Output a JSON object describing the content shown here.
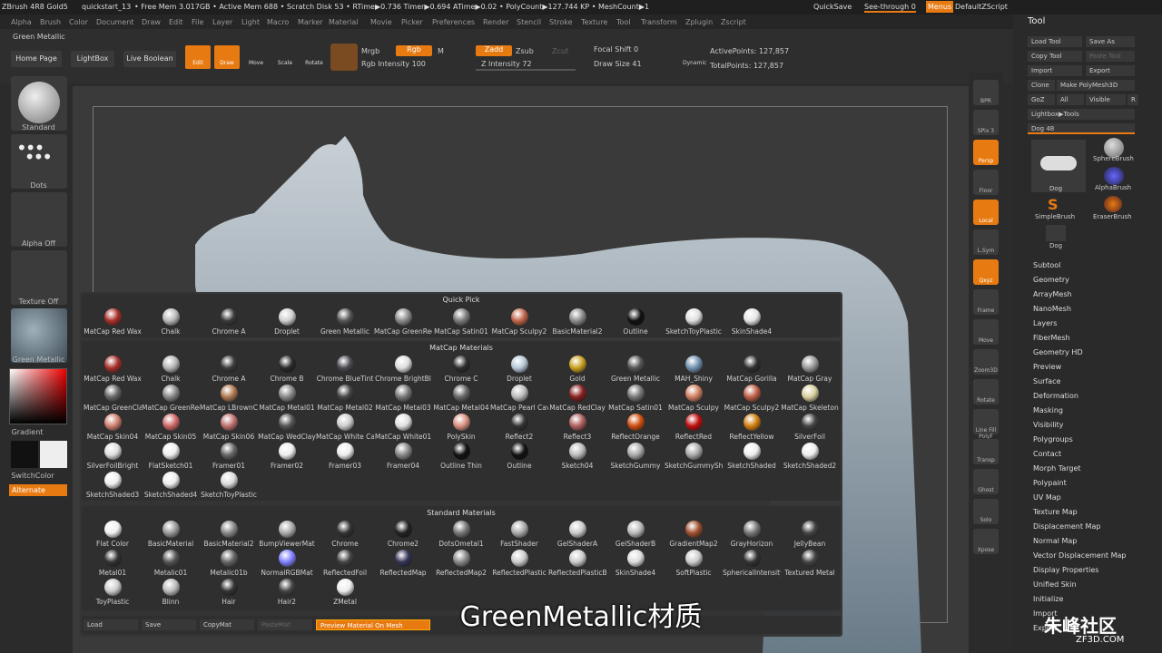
{
  "titlebar": {
    "items": [
      "ZBrush 4R8 Gold5",
      "quickstart_13",
      "• Free Mem 3.017GB • Active Mem 688 • Scratch Disk 53 • RTime▶0.736 Timer▶0.694 ATime▶0.02 • PolyCount▶127.744 KP • MeshCount▶1"
    ],
    "quicksave": "QuickSave",
    "seethrough": "See-through  0",
    "menus": "Menus",
    "script": "DefaultZScript"
  },
  "menu": [
    "Alpha",
    "Brush",
    "Color",
    "Document",
    "Draw",
    "Edit",
    "File",
    "Layer",
    "Light",
    "Macro",
    "Marker",
    "Material",
    "Movie",
    "Picker",
    "Preferences",
    "Render",
    "Stencil",
    "Stroke",
    "Texture",
    "Tool",
    "Transform",
    "Zplugin",
    "Zscript"
  ],
  "toolbar": {
    "material_name": "Green Metallic",
    "home": "Home Page",
    "lightbox": "LightBox",
    "liveboolean": "Live Boolean",
    "edit": "Edit",
    "draw": "Draw",
    "move": "Move",
    "scale": "Scale",
    "rotate": "Rotate",
    "mrgb": "Mrgb",
    "rgb": "Rgb",
    "m": "M",
    "zadd": "Zadd",
    "zsub": "Zsub",
    "zcut": "Zcut",
    "rgb_int": "Rgb Intensity 100",
    "z_int": "Z Intensity 72",
    "focal": "Focal Shift 0",
    "drawsize": "Draw Size 41",
    "dynamic": "Dynamic",
    "active": "ActivePoints: 127,857",
    "total": "TotalPoints: 127,857"
  },
  "left": {
    "standard": "Standard",
    "dots": "Dots",
    "alpha": "Alpha Off",
    "texture": "Texture Off",
    "material": "Green Metallic",
    "gradient": "Gradient",
    "switch": "SwitchColor",
    "alternate": "Alternate"
  },
  "strip": [
    "BPR",
    "SPix 3",
    "Persp",
    "Floor",
    "Local",
    "L.Sym",
    "Qxyz",
    "Frame",
    "Move",
    "Zoom3D",
    "Rotate",
    "Line Fill PolyF",
    "Transp",
    "Ghost",
    "Solo",
    "Xpose"
  ],
  "tool": {
    "title": "Tool",
    "load": "Load Tool",
    "saveas": "Save As",
    "copy": "Copy Tool",
    "paste": "Paste Tool",
    "import": "Import",
    "export": "Export",
    "clone": "Clone",
    "makepoly": "Make PolyMesh3D",
    "goz": "GoZ",
    "all": "All",
    "visible": "Visible",
    "r": "R",
    "lightboxtools": "Lightbox▶Tools",
    "dog": "Dog  48",
    "thumbs": [
      "Dog",
      "SphereBrush",
      "AlphaBrush",
      "SimpleBrush",
      "EraserBrush",
      "Dog"
    ],
    "list": [
      "Subtool",
      "Geometry",
      "ArrayMesh",
      "NanoMesh",
      "Layers",
      "FiberMesh",
      "Geometry HD",
      "Preview",
      "Surface",
      "Deformation",
      "Masking",
      "Visibility",
      "Polygroups",
      "Contact",
      "Morph Target",
      "Polypaint",
      "UV Map",
      "Texture Map",
      "Displacement Map",
      "Normal Map",
      "Vector Displacement Map",
      "Display Properties",
      "Unified Skin",
      "Initialize",
      "Import",
      "Export"
    ]
  },
  "popup": {
    "quick_title": "Quick Pick",
    "quick": [
      [
        "MatCap Red Wax",
        "#a8302a"
      ],
      [
        "Chalk",
        "#b9b9b9"
      ],
      [
        "Chrome A",
        "#3a3a3a"
      ],
      [
        "Droplet",
        "#d0d0d0"
      ],
      [
        "Green Metallic",
        "#555"
      ],
      [
        "MatCap GreenRed",
        "#8a8a8a"
      ],
      [
        "MatCap Satin01",
        "#7a7a7a"
      ],
      [
        "MatCap Sculpy2",
        "#c0664a"
      ],
      [
        "BasicMaterial2",
        "#8c8c8c"
      ],
      [
        "Outline",
        "#111"
      ],
      [
        "SketchToyPlastic",
        "#dedede"
      ],
      [
        "SkinShade4",
        "#e4e4e4"
      ]
    ],
    "matcap_title": "MatCap Materials",
    "matcap": [
      [
        "MatCap Red Wax",
        "#a8302a"
      ],
      [
        "Chalk",
        "#b5b5b5"
      ],
      [
        "Chrome A",
        "#3c3c3c"
      ],
      [
        "Chrome B",
        "#2a2a2a"
      ],
      [
        "Chrome BlueTint",
        "#4a4a52"
      ],
      [
        "Chrome BrightBl",
        "#dcdcdc"
      ],
      [
        "Chrome C",
        "#2e2e2e"
      ],
      [
        "Droplet",
        "#b8c8d8"
      ],
      [
        "Gold",
        "#c8a020"
      ],
      [
        "Green Metallic",
        "#555"
      ],
      [
        "MAH_Shiny",
        "#7090b0"
      ],
      [
        "MatCap Gorilla",
        "#303030"
      ],
      [
        "MatCap Gray",
        "#999"
      ],
      [
        "MatCap GreenClay",
        "#666"
      ],
      [
        "MatCap GreenRed",
        "#888"
      ],
      [
        "MatCap LBrownClay",
        "#b07850"
      ],
      [
        "MatCap Metal01",
        "#888"
      ],
      [
        "MatCap Metal02",
        "#444"
      ],
      [
        "MatCap Metal03",
        "#777"
      ],
      [
        "MatCap Metal04",
        "#666"
      ],
      [
        "MatCap Pearl Cavity",
        "#bbb"
      ],
      [
        "MatCap RedClay",
        "#8a2020"
      ],
      [
        "MatCap Satin01",
        "#777"
      ],
      [
        "MatCap Sculpy",
        "#d08060"
      ],
      [
        "MatCap Sculpy2",
        "#c06048"
      ],
      [
        "MatCap Skeleton",
        "#d8d0a0"
      ],
      [
        "MatCap Skin04",
        "#d08070"
      ],
      [
        "MatCap Skin05",
        "#d06868"
      ],
      [
        "MatCap Skin06",
        "#c07070"
      ],
      [
        "MatCap WedClay",
        "#555"
      ],
      [
        "MatCap White Cavity",
        "#ccc"
      ],
      [
        "MatCap White01",
        "#e0e0e0"
      ],
      [
        "PolySkin",
        "#d89080"
      ],
      [
        "Reflect2",
        "#333"
      ],
      [
        "Reflect3",
        "#b06060"
      ],
      [
        "ReflectOrange",
        "#d05010"
      ],
      [
        "ReflectRed",
        "#c01010"
      ],
      [
        "ReflectYellow",
        "#d08010"
      ],
      [
        "SilverFoil",
        "#444"
      ],
      [
        "SilverFoilBright",
        "#ddd"
      ],
      [
        "FlatSketch01",
        "#eee"
      ],
      [
        "Framer01",
        "#666"
      ],
      [
        "Framer02",
        "#eee"
      ],
      [
        "Framer03",
        "#eee"
      ],
      [
        "Framer04",
        "#888"
      ],
      [
        "Outline Thin",
        "#111"
      ],
      [
        "Outline",
        "#111"
      ],
      [
        "Sketch04",
        "#bbb"
      ],
      [
        "SketchGummy",
        "#aaa"
      ],
      [
        "SketchGummyShade",
        "#aaa"
      ],
      [
        "SketchShaded",
        "#eee"
      ],
      [
        "SketchShaded2",
        "#eee"
      ],
      [
        "SketchShaded3",
        "#eee"
      ],
      [
        "SketchShaded4",
        "#eee"
      ],
      [
        "SketchToyPlastic",
        "#ddd"
      ]
    ],
    "standard_title": "Standard Materials",
    "standard": [
      [
        "Flat Color",
        "#f0f0f0"
      ],
      [
        "BasicMaterial",
        "#999"
      ],
      [
        "BasicMaterial2",
        "#888"
      ],
      [
        "BumpViewerMat",
        "#aaa"
      ],
      [
        "Chrome",
        "#333"
      ],
      [
        "Chrome2",
        "#222"
      ],
      [
        "DotsOmetal1",
        "#777"
      ],
      [
        "FastShader",
        "#aaa"
      ],
      [
        "GelShaderA",
        "#ccc"
      ],
      [
        "GelShaderB",
        "#bbb"
      ],
      [
        "GradientMap2",
        "#a05030"
      ],
      [
        "GrayHorizon",
        "#777"
      ],
      [
        "JellyBean",
        "#444"
      ],
      [
        "Metal01",
        "#333"
      ],
      [
        "Metalic01",
        "#555"
      ],
      [
        "Metalic01b",
        "#666"
      ],
      [
        "NormalRGBMat",
        "#8080ff"
      ],
      [
        "ReflectedFoil",
        "#444"
      ],
      [
        "ReflectedMap",
        "#335"
      ],
      [
        "ReflectedMap2",
        "#888"
      ],
      [
        "ReflectedPlastic",
        "#ccc"
      ],
      [
        "ReflectedPlasticB",
        "#ccc"
      ],
      [
        "SkinShade4",
        "#ddd"
      ],
      [
        "SoftPlastic",
        "#ccc"
      ],
      [
        "SphericalIntensity",
        "#333"
      ],
      [
        "Textured Metal",
        "#444"
      ],
      [
        "ToyPlastic",
        "#ccc"
      ],
      [
        "Blinn",
        "#bbb"
      ],
      [
        "Hair",
        "#333"
      ],
      [
        "Hair2",
        "#444"
      ],
      [
        "ZMetal",
        "#eee"
      ]
    ],
    "bottom": {
      "load": "Load",
      "save": "Save",
      "copymat": "CopyMat",
      "pastemat": "PasteMat",
      "preview": "Preview Material On Mesh"
    }
  },
  "subtitle": "GreenMetallic材质",
  "watermark": "朱峰社区",
  "watermark_url": "ZF3D.COM"
}
